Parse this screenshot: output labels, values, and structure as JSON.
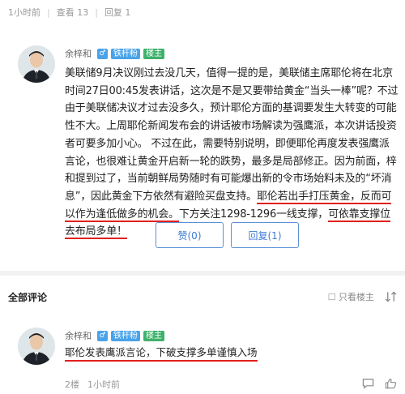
{
  "post_meta": {
    "time": "1小时前",
    "views": "查看 13",
    "replies": "回复 1"
  },
  "op": {
    "username": "余梓和",
    "sex_icon": "male-icon",
    "badge": "铁杆粉",
    "role": "楼主"
  },
  "post": {
    "text_1": "美联储9月决议刚过去没几天，值得一提的是，美联储主席耶伦将在北京时间27日00:45发表讲话，这次是不是又要带给黄金“当头一棒”呢？不过由于美联储决议才过去没多久，预计耶伦方面的基调要发生大转变的可能性不大。上周耶伦新闻发布会的讲话被市场解读为强鹰派，本次讲话投资者可要多加小心。    不过在此，需要特别说明，即便耶伦再度发表强鹰派言论，也很难让黄金开启新一轮的跌势，最多是局部修正。因为前面，梓和提到过了，当前朝鲜局势随时有可能爆出新的令市场始料未及的“坏消息”，因此黄金下方依然有避险买盘支持。",
    "highlight_1": "耶伦若出手打压黄金，反而可以作为逢低做多的机会。",
    "text_2": "下方关注1298-1296一线支撑，",
    "highlight_2": "可依靠支撑位去布局多单！"
  },
  "actions": {
    "like": "赞(0)",
    "reply": "回复(1)"
  },
  "comments": {
    "title": "全部评论",
    "only_op": "只看楼主",
    "sort_icon": "sort-icon"
  },
  "reply": {
    "username": "余梓和",
    "sex_icon": "male-icon",
    "badge": "铁杆粉",
    "role": "楼主",
    "text": "耶伦发表鹰派言论，下破支撑多单谨慎入场",
    "floor": "2楼",
    "time": "1小时前"
  },
  "colors": {
    "accent_blue": "#4aa3e8",
    "owner_green": "#3eb16b",
    "highlight_red": "#e0201c"
  }
}
